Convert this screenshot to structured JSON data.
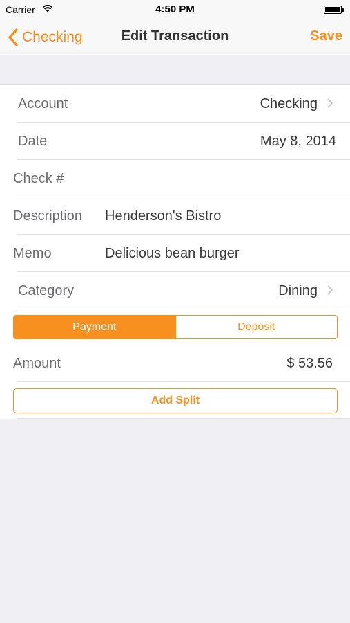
{
  "status_bar": {
    "carrier": "Carrier",
    "time": "4:50 PM"
  },
  "nav": {
    "back_label": "Checking",
    "title": "Edit Transaction",
    "save_label": "Save"
  },
  "form": {
    "account": {
      "label": "Account",
      "value": "Checking"
    },
    "date": {
      "label": "Date",
      "value": "May 8, 2014"
    },
    "check": {
      "label": "Check #",
      "value": ""
    },
    "description": {
      "label": "Description",
      "value": "Henderson's Bistro"
    },
    "memo": {
      "label": "Memo",
      "value": "Delicious bean burger"
    },
    "category": {
      "label": "Category",
      "value": "Dining"
    },
    "type_segment": {
      "options": [
        "Payment",
        "Deposit"
      ],
      "selected": "Payment"
    },
    "amount": {
      "label": "Amount",
      "value": "$ 53.56"
    },
    "add_split_label": "Add Split"
  },
  "colors": {
    "accent": "#f7901e",
    "background": "#efeff4",
    "label_gray": "#6d6d72"
  },
  "icons": {
    "back": "chevron-left-icon",
    "disclosure": "chevron-right-icon",
    "wifi": "wifi-icon",
    "battery": "battery-icon"
  }
}
